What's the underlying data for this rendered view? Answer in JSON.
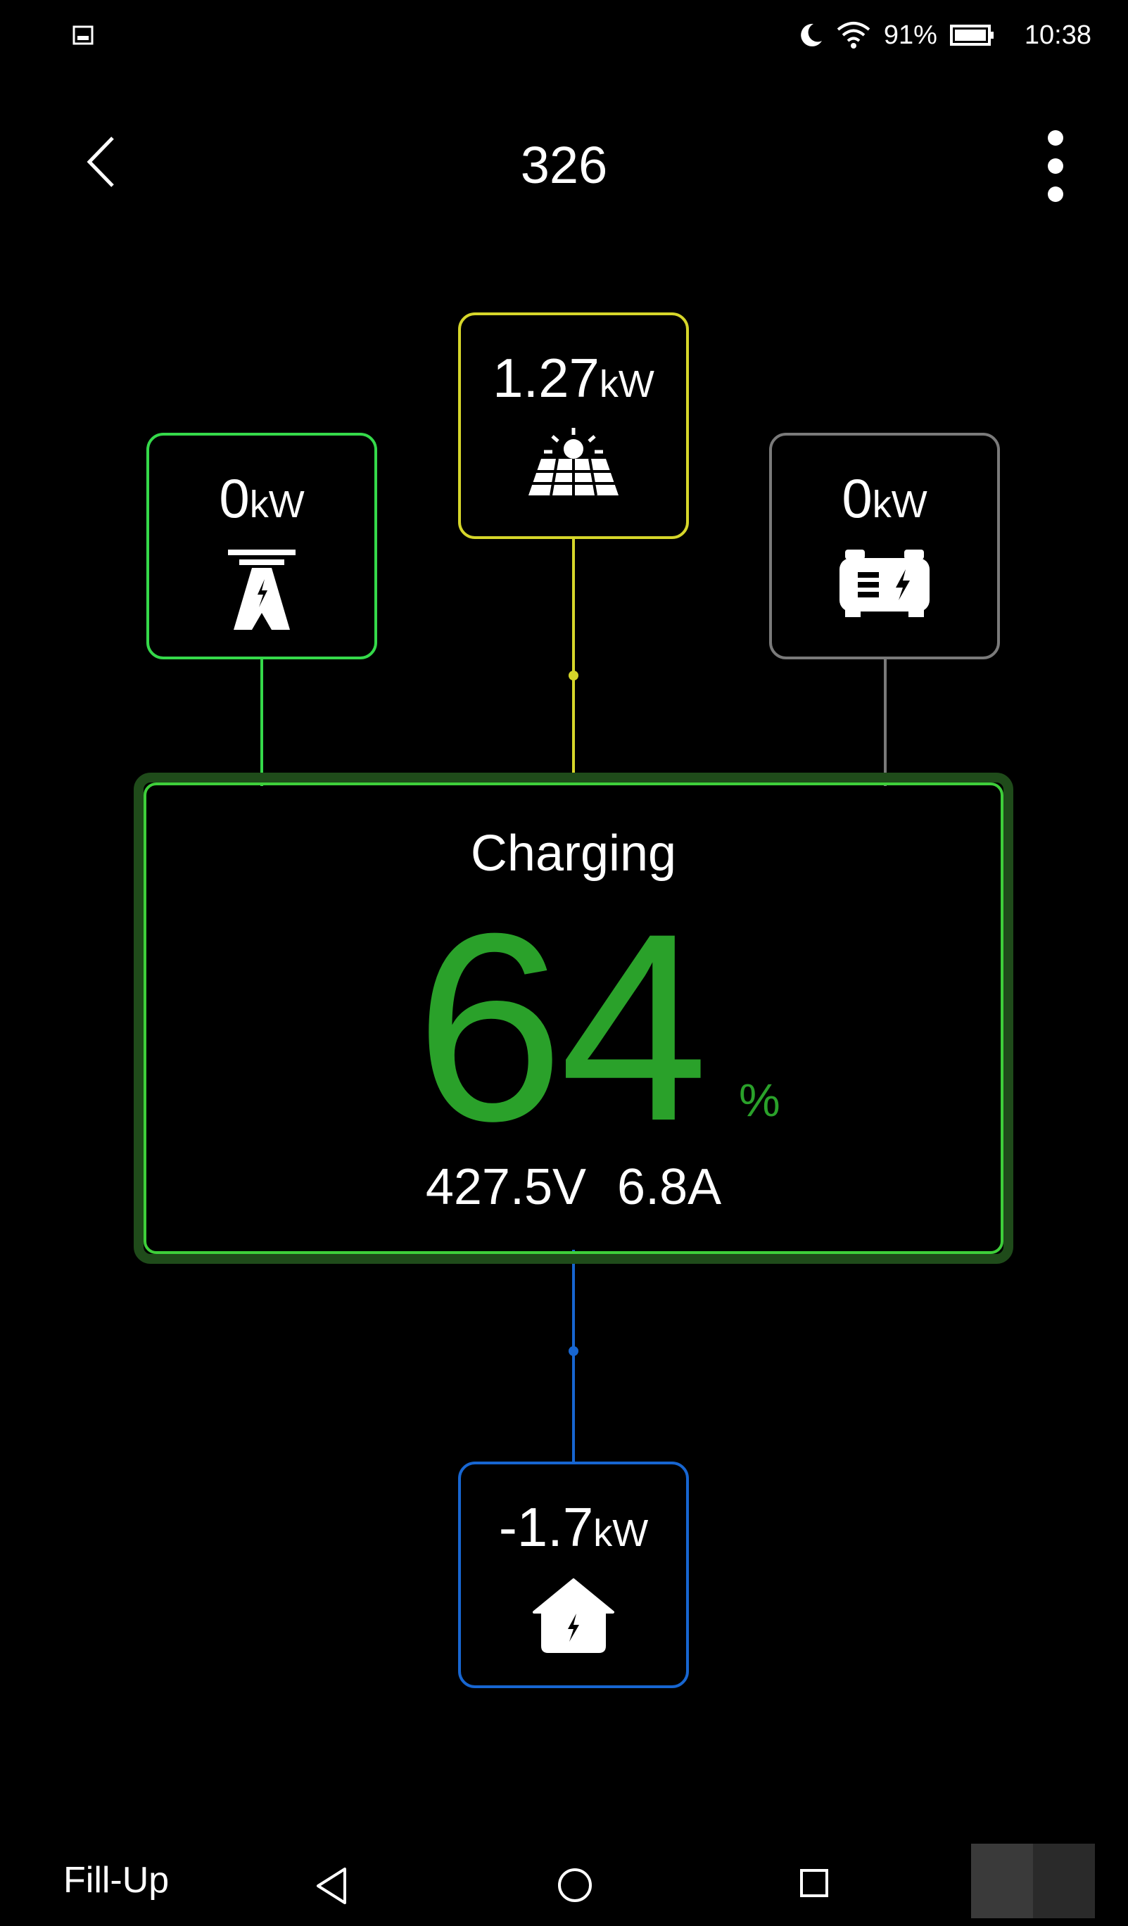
{
  "status_bar": {
    "battery_percent": "91%",
    "time": "10:38"
  },
  "app_bar": {
    "title": "326"
  },
  "sources": {
    "solar": {
      "value": "1.27",
      "unit": "kW",
      "color": "#d6d62a"
    },
    "grid": {
      "value": "0",
      "unit": "kW",
      "color": "#35d94a"
    },
    "generator": {
      "value": "0",
      "unit": "kW",
      "color": "#7a7a7a"
    }
  },
  "battery": {
    "status": "Charging",
    "soc": "64",
    "soc_unit": "%",
    "voltage": "427.5V",
    "current": "6.8A",
    "color": "#2aa12a"
  },
  "load": {
    "home": {
      "value": "-1.7",
      "unit": "kW",
      "color": "#1766d1"
    }
  },
  "nav_bar": {
    "label": "Fill-Up"
  }
}
